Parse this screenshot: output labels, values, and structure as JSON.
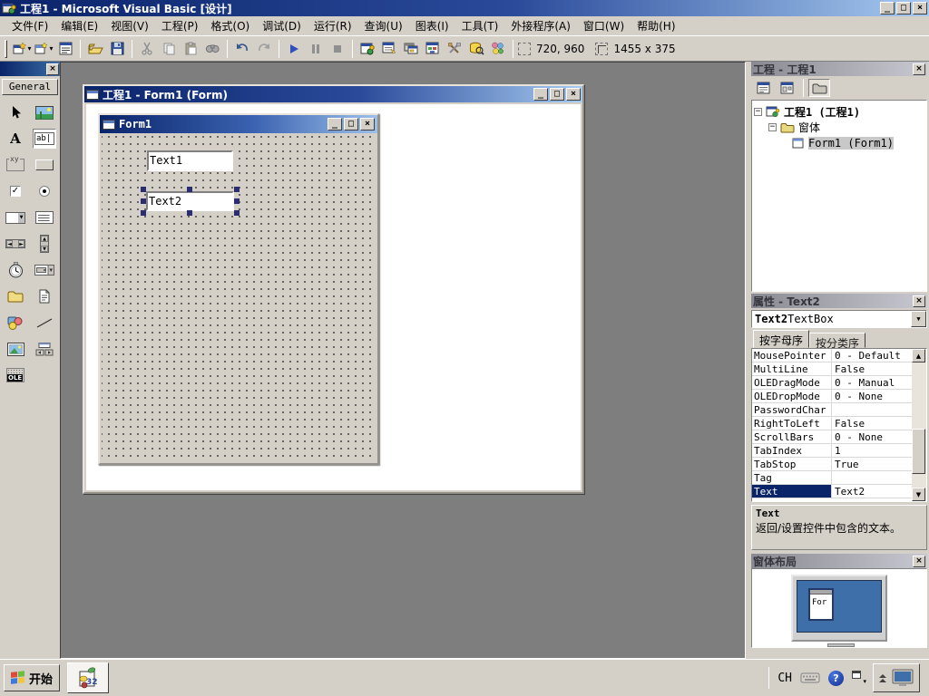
{
  "window": {
    "title": "工程1 - Microsoft Visual Basic [设计]"
  },
  "menubar": {
    "items": [
      "文件(F)",
      "编辑(E)",
      "视图(V)",
      "工程(P)",
      "格式(O)",
      "调试(D)",
      "运行(R)",
      "查询(U)",
      "图表(I)",
      "工具(T)",
      "外接程序(A)",
      "窗口(W)",
      "帮助(H)"
    ]
  },
  "toolbar": {
    "position": "720, 960",
    "size": "1455 x 375",
    "icon_names": [
      "add-project",
      "add-form",
      "menu-editor",
      "open-project",
      "save-project",
      "cut",
      "copy",
      "paste",
      "find",
      "undo",
      "redo",
      "start",
      "break",
      "end",
      "project-explorer",
      "properties-window",
      "form-layout-window",
      "object-browser",
      "toolbox",
      "data-view-window",
      "component-manager"
    ]
  },
  "toolbox": {
    "tab": "General",
    "glyphs": {
      "label": "A",
      "textbox": "ab|",
      "frame": "xy",
      "ole": "OLE"
    },
    "tool_names": [
      "pointer",
      "picturebox",
      "label",
      "textbox",
      "frame",
      "commandbutton",
      "checkbox",
      "optionbutton",
      "combobox",
      "listbox",
      "hscrollbar",
      "vscrollbar",
      "timer",
      "drivelistbox",
      "dirlistbox",
      "filelistbox",
      "shape",
      "line",
      "image",
      "data",
      "ole"
    ]
  },
  "designer": {
    "doc_title": "工程1 - Form1 (Form)",
    "form_title": "Form1",
    "text1": "Text1",
    "text2": "Text2"
  },
  "project_panel": {
    "title": "工程 - 工程1",
    "tree": {
      "root": "工程1 (工程1)",
      "folder": "窗体",
      "form": "Form1 (Form1)"
    }
  },
  "properties_panel": {
    "title": "属性 - Text2",
    "object_name": "Text2",
    "object_type": " TextBox",
    "tabs": [
      "按字母序",
      "按分类序"
    ],
    "rows": [
      {
        "name": "MousePointer",
        "value": "0 - Default"
      },
      {
        "name": "MultiLine",
        "value": "False"
      },
      {
        "name": "OLEDragMode",
        "value": "0 - Manual"
      },
      {
        "name": "OLEDropMode",
        "value": "0 - None"
      },
      {
        "name": "PasswordChar",
        "value": ""
      },
      {
        "name": "RightToLeft",
        "value": "False"
      },
      {
        "name": "ScrollBars",
        "value": "0 - None"
      },
      {
        "name": "TabIndex",
        "value": "1"
      },
      {
        "name": "TabStop",
        "value": "True"
      },
      {
        "name": "Tag",
        "value": ""
      },
      {
        "name": "Text",
        "value": "Text2",
        "selected": true
      }
    ],
    "description_title": "Text",
    "description": "返回/设置控件中包含的文本。"
  },
  "form_layout_panel": {
    "title": "窗体布局",
    "mini_form_label": "For"
  },
  "taskbar": {
    "start": "开始",
    "lang": "CH",
    "help": "?"
  },
  "icons": {
    "minimize": "_",
    "maximize": "□",
    "close": "×",
    "dropdown": "▾",
    "combo_arrow": "▼",
    "up": "▲",
    "down": "▼",
    "left": "◄",
    "right": "►",
    "collapse": "−",
    "check": "✓"
  },
  "colors": {
    "active_title_start": "#0a246a",
    "active_title_end": "#a6caf0",
    "selection": "#0a246a",
    "chrome": "#d4d0c8",
    "mdi_background": "#7e7e7e",
    "handle": "#2c2c70",
    "screen_blue": "#3f6fa8"
  }
}
